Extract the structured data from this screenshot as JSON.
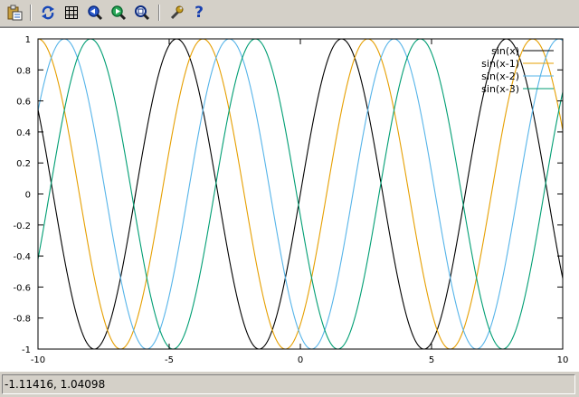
{
  "toolbar": {
    "buttons": [
      {
        "name": "copy-to-clipboard",
        "icon": "clipboard-icon"
      },
      {
        "name": "replot",
        "icon": "refresh-icon"
      },
      {
        "name": "toggle-grid",
        "icon": "grid-icon"
      },
      {
        "name": "zoom-previous",
        "icon": "zoom-previous-icon"
      },
      {
        "name": "zoom-next",
        "icon": "zoom-next-icon"
      },
      {
        "name": "autoscale",
        "icon": "zoom-autoscale-icon"
      },
      {
        "name": "options",
        "icon": "wrench-icon"
      },
      {
        "name": "help",
        "icon": "help-icon",
        "label": "?"
      }
    ]
  },
  "statusbar": {
    "coordinates": "-1.11416, 1.04098"
  },
  "chart_data": {
    "type": "line",
    "xlim": [
      -10,
      10
    ],
    "ylim": [
      -1,
      1
    ],
    "xticks": [
      "-10",
      "-5",
      "0",
      "5",
      "10"
    ],
    "yticks": [
      "-1",
      "-0.8",
      "-0.6",
      "-0.4",
      "-0.2",
      "0",
      "0.2",
      "0.4",
      "0.6",
      "0.8",
      "1"
    ],
    "grid": false,
    "legend_position": "top-right",
    "series": [
      {
        "name": "sin(x)",
        "function": "sin(x)",
        "shift": 0,
        "color": "#000000"
      },
      {
        "name": "sin(x-1)",
        "function": "sin(x-1)",
        "shift": 1,
        "color": "#e69f00"
      },
      {
        "name": "sin(x-2)",
        "function": "sin(x-2)",
        "shift": 2,
        "color": "#56b4e9"
      },
      {
        "name": "sin(x-3)",
        "function": "sin(x-3)",
        "shift": 3,
        "color": "#009e73"
      }
    ]
  }
}
